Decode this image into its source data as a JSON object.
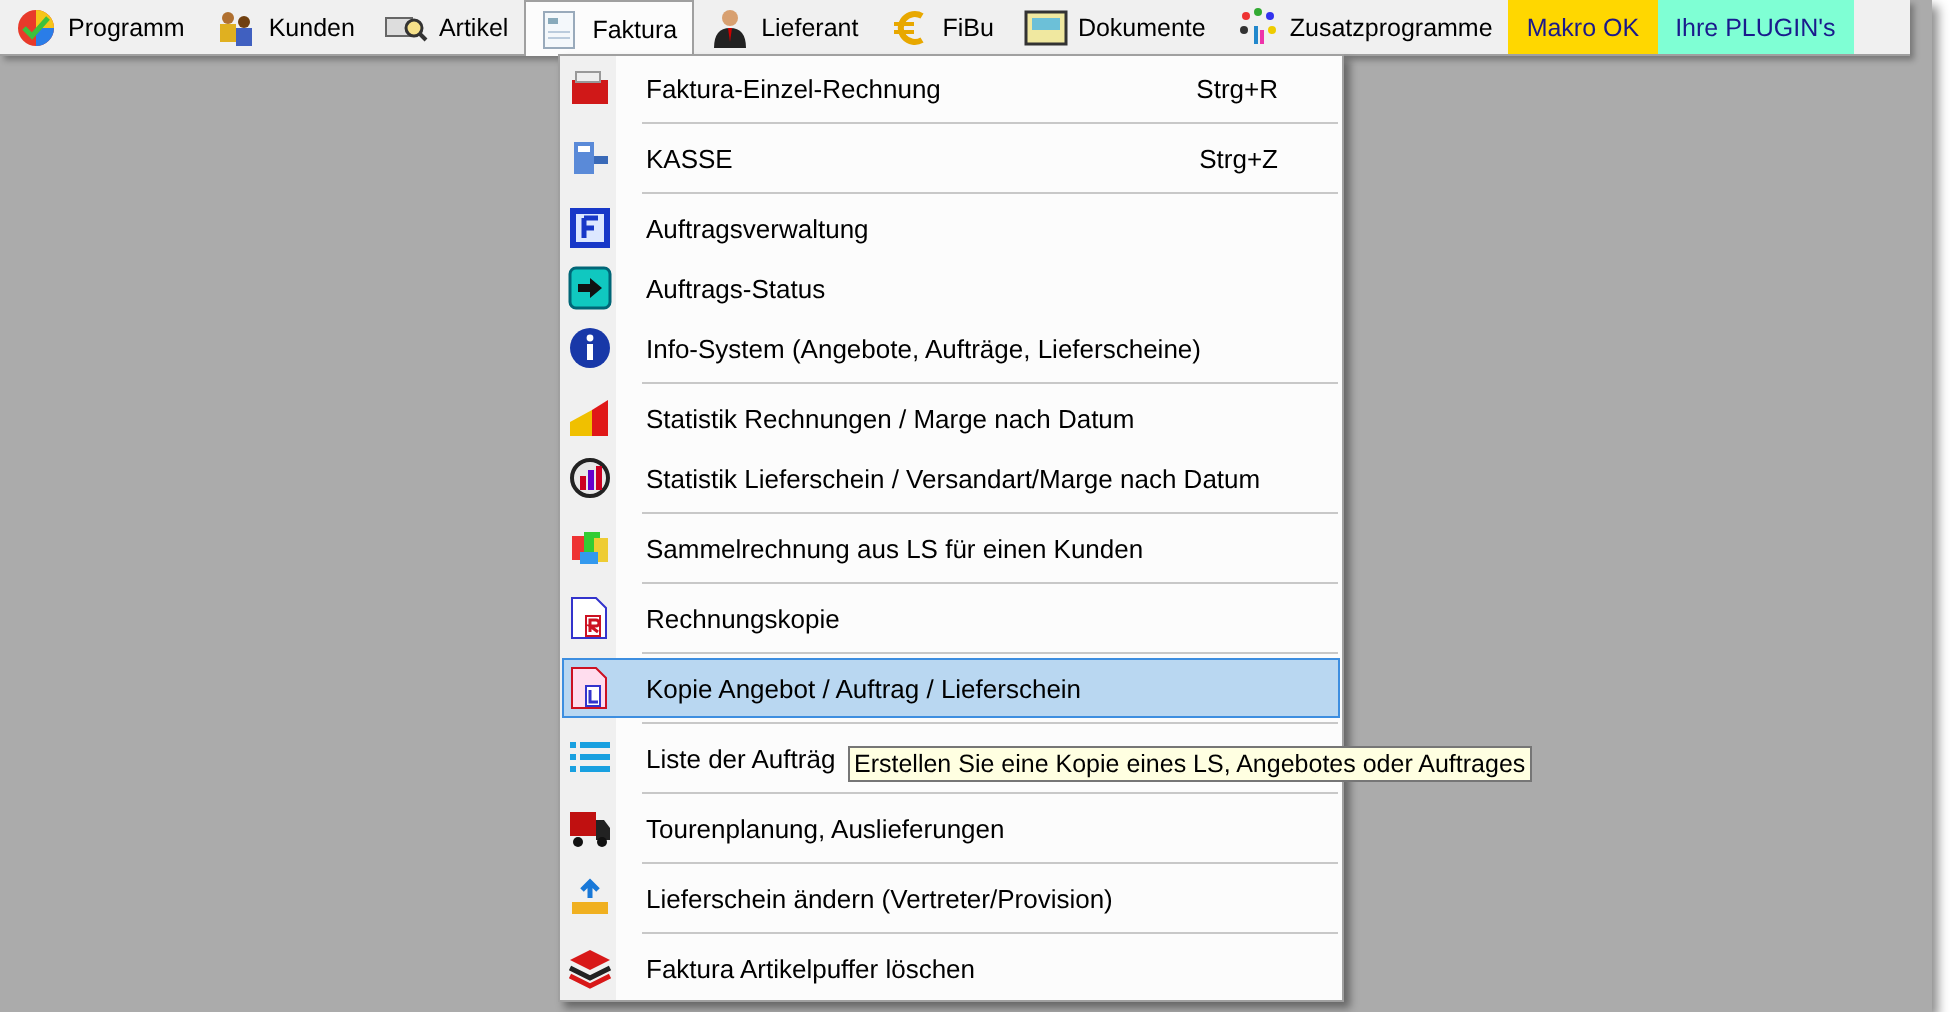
{
  "menubar": [
    {
      "kind": "menu",
      "label": "Programm",
      "selected": false
    },
    {
      "kind": "menu",
      "label": "Kunden",
      "selected": false
    },
    {
      "kind": "menu",
      "label": "Artikel",
      "selected": false
    },
    {
      "kind": "menu",
      "label": "Faktura",
      "selected": true
    },
    {
      "kind": "menu",
      "label": "Lieferant",
      "selected": false
    },
    {
      "kind": "menu",
      "label": "FiBu",
      "selected": false
    },
    {
      "kind": "menu",
      "label": "Dokumente",
      "selected": false
    },
    {
      "kind": "menu",
      "label": "Zusatzprogramme",
      "selected": false
    },
    {
      "kind": "button",
      "label": "Makro OK",
      "color": "#ffd700",
      "selected": false
    },
    {
      "kind": "button",
      "label": "Ihre PLUGIN's",
      "color": "#7fffd4",
      "selected": false
    }
  ],
  "dropdown": {
    "groups": [
      [
        {
          "label": "Faktura-Einzel-Rechnung",
          "shortcut": "Strg+R",
          "selected": false
        }
      ],
      [
        {
          "label": "KASSE",
          "shortcut": "Strg+Z",
          "selected": false
        }
      ],
      [
        {
          "label": "Auftragsverwaltung",
          "selected": false
        },
        {
          "label": "Auftrags-Status",
          "selected": false
        },
        {
          "label": "Info-System (Angebote, Aufträge, Lieferscheine)",
          "selected": false
        }
      ],
      [
        {
          "label": "Statistik Rechnungen / Marge nach Datum",
          "selected": false
        },
        {
          "label": "Statistik Lieferschein / Versandart/Marge nach Datum",
          "selected": false
        }
      ],
      [
        {
          "label": "Sammelrechnung aus LS für einen Kunden",
          "selected": false
        }
      ],
      [
        {
          "label": "Rechnungskopie",
          "selected": false
        }
      ],
      [
        {
          "label": "Kopie Angebot / Auftrag / Lieferschein",
          "selected": true
        }
      ],
      [
        {
          "label": "Liste der Aufträg",
          "selected": false
        }
      ],
      [
        {
          "label": "Tourenplanung, Auslieferungen",
          "selected": false
        }
      ],
      [
        {
          "label": "Lieferschein ändern (Vertreter/Provision)",
          "selected": false
        }
      ],
      [
        {
          "label": "Faktura Artikelpuffer löschen",
          "selected": false
        }
      ]
    ]
  },
  "tooltip": "Erstellen Sie eine Kopie eines LS, Angebotes oder Auftrages"
}
